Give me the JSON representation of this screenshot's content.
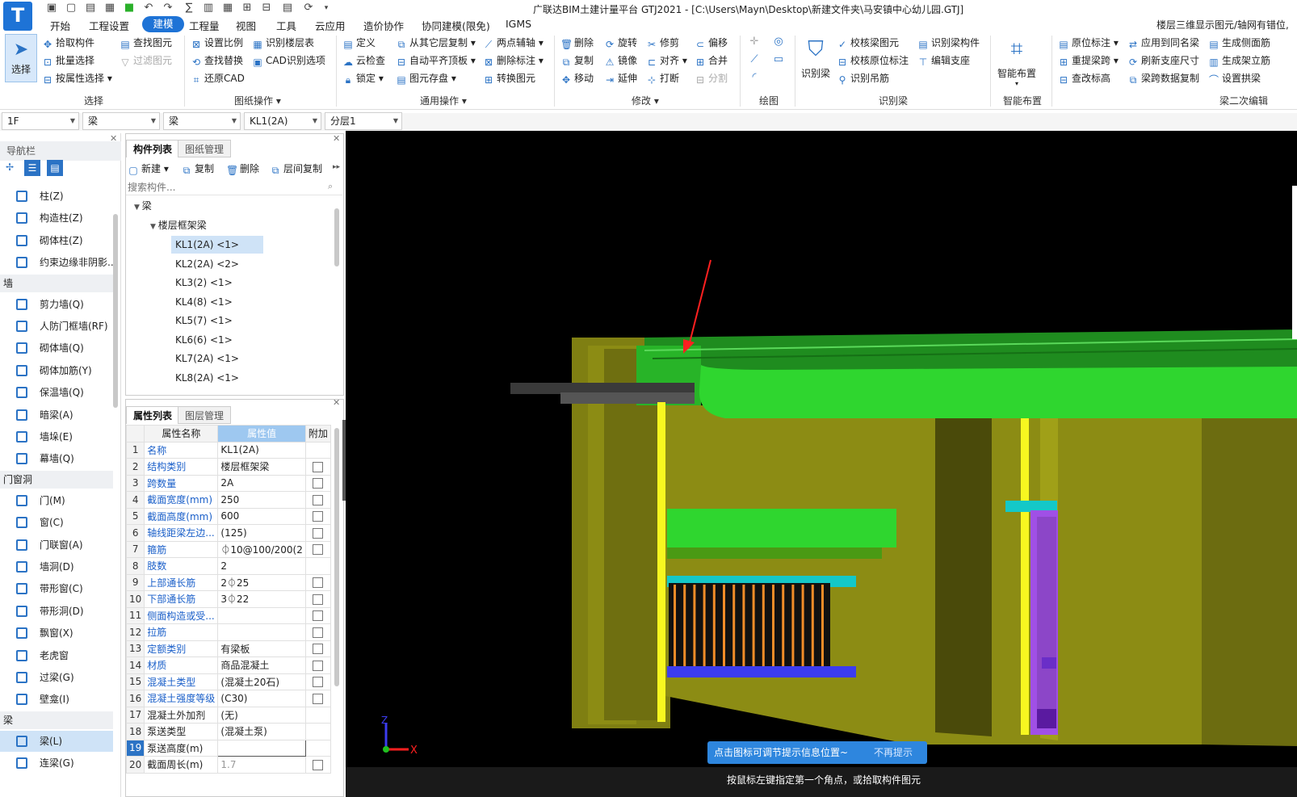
{
  "app": {
    "title": "广联达BIM土建计量平台 GTJ2021 - [C:\\Users\\Mayn\\Desktop\\新建文件夹\\马安镇中心幼儿园.GTJ]",
    "logo": "T"
  },
  "menu": [
    "开始",
    "工程设置",
    "建模",
    "工程量",
    "视图",
    "工具",
    "云应用",
    "造价协作",
    "协同建模(限免)",
    "IGMS"
  ],
  "topright": "楼层三维显示图元/轴网有错位,",
  "ribbon": {
    "select_big": "选择",
    "select_col": [
      "拾取构件",
      "批量选择",
      "按属性选择"
    ],
    "select_col2": [
      "查找图元",
      "过滤图元"
    ],
    "group_select": "选择",
    "draw_ops1": [
      "设置比例",
      "查找替换",
      "还原CAD"
    ],
    "draw_ops2": [
      "识别楼层表",
      "CAD识别选项"
    ],
    "group_drawing": "图纸操作",
    "common1": [
      "定义",
      "云检查",
      "锁定"
    ],
    "common2": [
      "从其它层复制",
      "自动平齐顶板",
      "图元存盘"
    ],
    "common3": [
      "两点辅轴",
      "删除标注",
      "转换图元"
    ],
    "group_common": "通用操作",
    "modify1": [
      "删除",
      "复制",
      "移动"
    ],
    "modify2": [
      "旋转",
      "镜像",
      "延伸"
    ],
    "modify3": [
      "修剪",
      "对齐",
      "打断"
    ],
    "modify4": [
      "偏移",
      "合并",
      "分割"
    ],
    "group_modify": "修改",
    "group_draw": "绘图",
    "recog_big": "识别梁",
    "recog1": [
      "校核梁图元",
      "校核原位标注",
      "识别吊筋"
    ],
    "recog2": [
      "识别梁构件",
      "编辑支座"
    ],
    "group_recog": "识别梁",
    "smart_big": "智能布置",
    "group_smart": "智能布置",
    "edit1": [
      "原位标注",
      "重提梁跨",
      "查改标高"
    ],
    "edit2": [
      "应用到同名梁",
      "刷新支座尺寸",
      "梁跨数据复制"
    ],
    "edit3": [
      "生成侧面筋",
      "生成架立筋",
      "设置拱梁"
    ],
    "group_edit": "梁二次编辑"
  },
  "combos": [
    "1F",
    "梁",
    "梁",
    "KL1(2A)",
    "分层1"
  ],
  "nav": {
    "header": "导航栏",
    "items1": [
      "柱(Z)",
      "构造柱(Z)",
      "砌体柱(Z)",
      "约束边缘非阴影..."
    ],
    "sec_wall": "墙",
    "items2": [
      "剪力墙(Q)",
      "人防门框墙(RF)",
      "砌体墙(Q)",
      "砌体加筋(Y)",
      "保温墙(Q)",
      "暗梁(A)",
      "墙垛(E)",
      "幕墙(Q)"
    ],
    "sec_door": "门窗洞",
    "items3": [
      "门(M)",
      "窗(C)",
      "门联窗(A)",
      "墙洞(D)",
      "带形窗(C)",
      "带形洞(D)",
      "飘窗(X)",
      "老虎窗",
      "过梁(G)",
      "壁龛(I)"
    ],
    "sec_beam": "梁",
    "items4": [
      "梁(L)",
      "连梁(G)"
    ]
  },
  "comp": {
    "tabs": [
      "构件列表",
      "图纸管理"
    ],
    "tools": [
      "新建",
      "复制",
      "删除",
      "层间复制"
    ],
    "search_placeholder": "搜索构件...",
    "root": "梁",
    "group": "楼层框架梁",
    "items": [
      "KL1(2A) <1>",
      "KL2(2A) <2>",
      "KL3(2) <1>",
      "KL4(8) <1>",
      "KL5(7) <1>",
      "KL6(6) <1>",
      "KL7(2A) <1>",
      "KL8(2A) <1>"
    ]
  },
  "prop": {
    "tabs": [
      "属性列表",
      "图层管理"
    ],
    "headers": [
      "属性名称",
      "属性值",
      "附加"
    ],
    "rows": [
      [
        "1",
        "名称",
        "KL1(2A)",
        "n"
      ],
      [
        "2",
        "结构类别",
        "楼层框架梁",
        "c"
      ],
      [
        "3",
        "跨数量",
        "2A",
        "c"
      ],
      [
        "4",
        "截面宽度(mm)",
        "250",
        "c"
      ],
      [
        "5",
        "截面高度(mm)",
        "600",
        "c"
      ],
      [
        "6",
        "轴线距梁左边...",
        "(125)",
        "c"
      ],
      [
        "7",
        "箍筋",
        "⏀10@100/200(2",
        "c"
      ],
      [
        "8",
        "肢数",
        "2",
        "n"
      ],
      [
        "9",
        "上部通长筋",
        "2⏀25",
        "c"
      ],
      [
        "10",
        "下部通长筋",
        "3⏀22",
        "c"
      ],
      [
        "11",
        "侧面构造或受...",
        "",
        "c"
      ],
      [
        "12",
        "拉筋",
        "",
        "c"
      ],
      [
        "13",
        "定额类别",
        "有梁板",
        "c"
      ],
      [
        "14",
        "材质",
        "商品混凝土",
        "c"
      ],
      [
        "15",
        "混凝土类型",
        "(混凝土20石)",
        "c"
      ],
      [
        "16",
        "混凝土强度等级",
        "(C30)",
        "c"
      ],
      [
        "17",
        "混凝土外加剂",
        "(无)",
        "n"
      ],
      [
        "18",
        "泵送类型",
        "(混凝土泵)",
        "n"
      ],
      [
        "19",
        "泵送高度(m)",
        "",
        "n"
      ],
      [
        "20",
        "截面周长(m)",
        "1.7",
        "c"
      ]
    ]
  },
  "viewport": {
    "tip": "点击图标可调节提示信息位置~",
    "tip_off": "不再提示",
    "status": "按鼠标左键指定第一个角点，或拾取构件图元",
    "axis_x": "X",
    "axis_z": "Z"
  },
  "colors": {
    "accent": "#1e73d6",
    "beam_green": "#2fd62f",
    "wall_olive": "#8c8c14",
    "yellow": "#f7f720",
    "cyan": "#14c8c8",
    "purple": "#a050e6",
    "blue": "#3c3cf0",
    "orange": "#f08c28"
  }
}
